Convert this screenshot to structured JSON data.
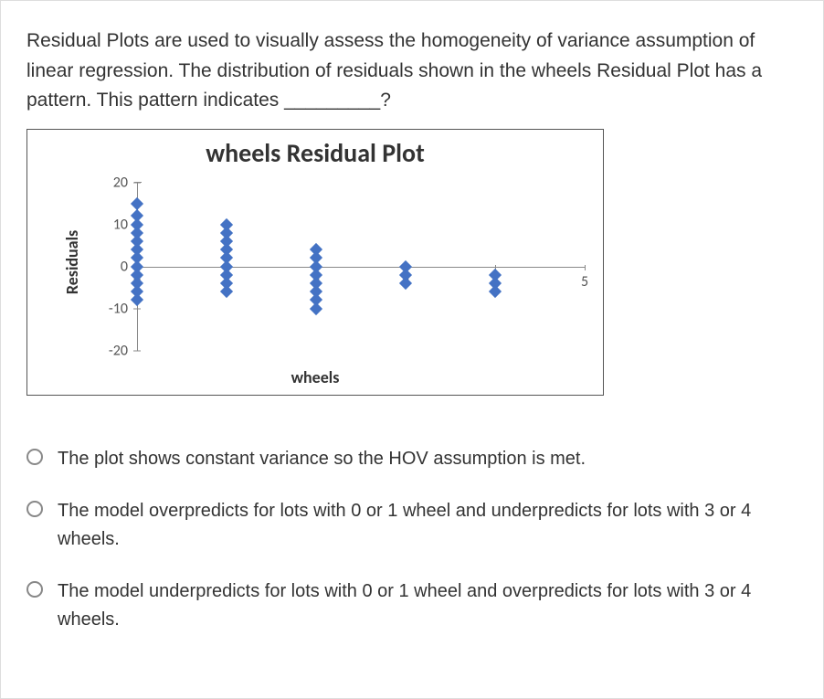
{
  "question": {
    "stem": "Residual Plots are used to visually assess the homogeneity of variance assumption of linear regression. The distribution of residuals shown in the wheels Residual Plot has a pattern. This pattern indicates _________?"
  },
  "chart_data": {
    "type": "scatter",
    "title": "wheels  Residual Plot",
    "xlabel": "wheels",
    "ylabel": "Residuals",
    "xlim": [
      0,
      5
    ],
    "ylim": [
      -20,
      20
    ],
    "yticks": [
      -20,
      -10,
      0,
      10,
      20
    ],
    "xticks": [
      0,
      1,
      2,
      3,
      4,
      5
    ],
    "series": [
      {
        "name": "residuals",
        "points": [
          {
            "x": 0,
            "y": 15
          },
          {
            "x": 0,
            "y": 12
          },
          {
            "x": 0,
            "y": 10
          },
          {
            "x": 0,
            "y": 8
          },
          {
            "x": 0,
            "y": 6
          },
          {
            "x": 0,
            "y": 4
          },
          {
            "x": 0,
            "y": 2
          },
          {
            "x": 0,
            "y": 0
          },
          {
            "x": 0,
            "y": -2
          },
          {
            "x": 0,
            "y": -4
          },
          {
            "x": 0,
            "y": -6
          },
          {
            "x": 0,
            "y": -8
          },
          {
            "x": 1,
            "y": 10
          },
          {
            "x": 1,
            "y": 8
          },
          {
            "x": 1,
            "y": 6
          },
          {
            "x": 1,
            "y": 4
          },
          {
            "x": 1,
            "y": 2
          },
          {
            "x": 1,
            "y": 0
          },
          {
            "x": 1,
            "y": -2
          },
          {
            "x": 1,
            "y": -4
          },
          {
            "x": 1,
            "y": -6
          },
          {
            "x": 2,
            "y": 4
          },
          {
            "x": 2,
            "y": 2
          },
          {
            "x": 2,
            "y": 0
          },
          {
            "x": 2,
            "y": -2
          },
          {
            "x": 2,
            "y": -4
          },
          {
            "x": 2,
            "y": -6
          },
          {
            "x": 2,
            "y": -8
          },
          {
            "x": 2,
            "y": -10
          },
          {
            "x": 3,
            "y": 0
          },
          {
            "x": 3,
            "y": -2
          },
          {
            "x": 3,
            "y": -4
          },
          {
            "x": 4,
            "y": -2
          },
          {
            "x": 4,
            "y": -4
          },
          {
            "x": 4,
            "y": -6
          }
        ]
      }
    ]
  },
  "options": [
    {
      "label": "The plot shows constant variance so the HOV assumption is met."
    },
    {
      "label": "The model overpredicts for lots with 0 or 1 wheel and underpredicts for lots with 3 or 4 wheels."
    },
    {
      "label": "The model underpredicts for lots with 0 or 1 wheel and overpredicts for lots with 3 or 4 wheels."
    }
  ]
}
